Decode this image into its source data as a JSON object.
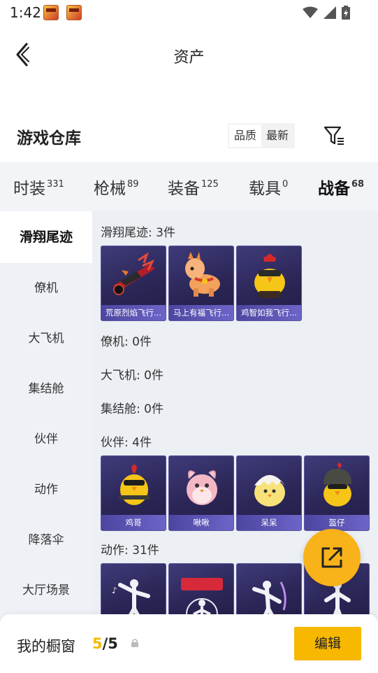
{
  "status_bar": {
    "time": "1:42"
  },
  "header": {
    "title": "资产"
  },
  "warehouse": {
    "title": "游戏仓库",
    "sort_options": [
      "品质",
      "最新"
    ]
  },
  "tabs": [
    {
      "label": "时装",
      "count": "331"
    },
    {
      "label": "枪械",
      "count": "89"
    },
    {
      "label": "装备",
      "count": "125"
    },
    {
      "label": "载具",
      "count": "0"
    },
    {
      "label": "战备",
      "count": "68"
    }
  ],
  "sidebar": {
    "items": [
      {
        "label": "滑翔尾迹"
      },
      {
        "label": "僚机"
      },
      {
        "label": "大飞机"
      },
      {
        "label": "集结舱"
      },
      {
        "label": "伙伴"
      },
      {
        "label": "动作"
      },
      {
        "label": "降落伞"
      },
      {
        "label": "大厅场景"
      }
    ]
  },
  "sections": {
    "glide_trail": {
      "title": "滑翔尾迹: 3件",
      "items": [
        {
          "label": "荒原烈焰飞行...",
          "icon": "flame-bike-icon"
        },
        {
          "label": "马上有福飞行...",
          "icon": "lucky-horse-icon"
        },
        {
          "label": "鸡智如我飞行...",
          "icon": "rooster-chick-icon"
        }
      ]
    },
    "wingman": {
      "title": "僚机: 0件"
    },
    "big_plane": {
      "title": "大飞机: 0件"
    },
    "assembly_pod": {
      "title": "集结舱: 0件"
    },
    "partner": {
      "title": "伙伴: 4件",
      "items": [
        {
          "label": "鸡哥",
          "icon": "chicken-sunglasses-icon"
        },
        {
          "label": "啾啾",
          "icon": "pink-bird-icon"
        },
        {
          "label": "呆呆",
          "icon": "egg-chick-icon"
        },
        {
          "label": "盔仔",
          "icon": "helmet-chick-icon"
        }
      ]
    },
    "emote": {
      "title": "动作: 31件"
    }
  },
  "bottom": {
    "showcase_label": "我的橱窗",
    "showcase_current": "5",
    "showcase_total": "/5",
    "edit_label": "编辑"
  },
  "colors": {
    "accent": "#f8b800",
    "card_bg": "#2b2656",
    "card_label": "#5a52b8"
  }
}
